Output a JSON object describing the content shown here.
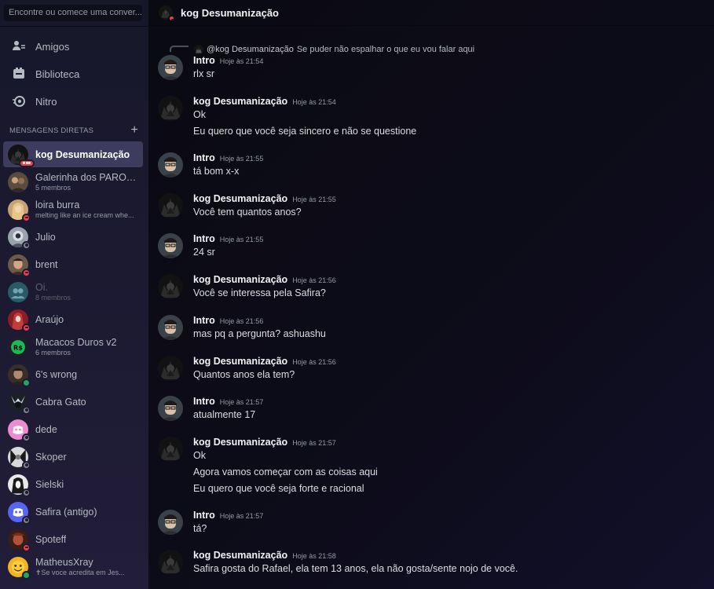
{
  "search": {
    "placeholder": "Encontre ou comece uma conver..."
  },
  "nav": [
    {
      "label": "Amigos",
      "icon": "friends-icon"
    },
    {
      "label": "Biblioteca",
      "icon": "library-icon"
    },
    {
      "label": "Nitro",
      "icon": "nitro-icon"
    }
  ],
  "dm_header": {
    "label": "MENSAGENS DIRETAS",
    "add": "+"
  },
  "dms": [
    {
      "name": "kog Desumanização",
      "sub": "",
      "status": "typing",
      "active": true
    },
    {
      "name": "Galerinha dos PARON...",
      "sub": "5 membros",
      "status": "none"
    },
    {
      "name": "loira burra",
      "sub": "melting like an ice cream whe...",
      "status": "dnd"
    },
    {
      "name": "Julio",
      "sub": "",
      "status": "offline"
    },
    {
      "name": "brent",
      "sub": "",
      "status": "dnd"
    },
    {
      "name": "Oi.",
      "sub": "8 membros",
      "status": "none",
      "muted": true
    },
    {
      "name": "Araújo",
      "sub": "",
      "status": "dnd"
    },
    {
      "name": "Macacos Duros v2",
      "sub": "6 membros",
      "status": "none"
    },
    {
      "name": "6's wrong",
      "sub": "",
      "status": "online"
    },
    {
      "name": "Cabra Gato",
      "sub": "",
      "status": "offline"
    },
    {
      "name": "dede",
      "sub": "",
      "status": "offline"
    },
    {
      "name": "Skoper",
      "sub": "",
      "status": "offline"
    },
    {
      "name": "Sielski",
      "sub": "",
      "status": "offline"
    },
    {
      "name": "Safira (antigo)",
      "sub": "",
      "status": "offline"
    },
    {
      "name": "Spoteff",
      "sub": "",
      "status": "dnd"
    },
    {
      "name": "MatheusXray",
      "sub": "✝Se voce acredita em Jes...",
      "status": "online"
    }
  ],
  "header": {
    "title": "kog Desumanização"
  },
  "reply": {
    "author": "@kog Desumanização",
    "text": "Se puder não espalhar o que eu vou falar aqui"
  },
  "messages": [
    {
      "author": "Intro",
      "time": "Hoje às 21:54",
      "lines": [
        "rlx sr"
      ]
    },
    {
      "author": "kog Desumanização",
      "time": "Hoje às 21:54",
      "lines": [
        "Ok",
        "Eu quero que você seja sincero e não se questione"
      ]
    },
    {
      "author": "Intro",
      "time": "Hoje às 21:55",
      "lines": [
        "tá bom x-x"
      ]
    },
    {
      "author": "kog Desumanização",
      "time": "Hoje às 21:55",
      "lines": [
        "Você tem quantos anos?"
      ]
    },
    {
      "author": "Intro",
      "time": "Hoje às 21:55",
      "lines": [
        "24 sr"
      ]
    },
    {
      "author": "kog Desumanização",
      "time": "Hoje às 21:56",
      "lines": [
        "Você se interessa pela Safira?"
      ]
    },
    {
      "author": "Intro",
      "time": "Hoje às 21:56",
      "lines": [
        "mas pq a pergunta? ashuashu"
      ]
    },
    {
      "author": "kog Desumanização",
      "time": "Hoje às 21:56",
      "lines": [
        "Quantos anos ela tem?"
      ]
    },
    {
      "author": "Intro",
      "time": "Hoje às 21:57",
      "lines": [
        "atualmente 17"
      ]
    },
    {
      "author": "kog Desumanização",
      "time": "Hoje às 21:57",
      "lines": [
        "Ok",
        "Agora vamos começar com as coisas aqui",
        "Eu quero que você seja forte e racional"
      ]
    },
    {
      "author": "Intro",
      "time": "Hoje às 21:57",
      "lines": [
        "tá?"
      ]
    },
    {
      "author": "kog Desumanização",
      "time": "Hoje às 21:58",
      "lines": [
        "Safira gosta do Rafael, ela tem 13 anos, ela não gosta/sente nojo de você."
      ]
    }
  ],
  "colors": {
    "sidebar_bg": "#1d1b33",
    "active_dm": "#3d3b5e",
    "dnd": "#f23f43",
    "online": "#23a55a",
    "offline": "#80848e"
  }
}
